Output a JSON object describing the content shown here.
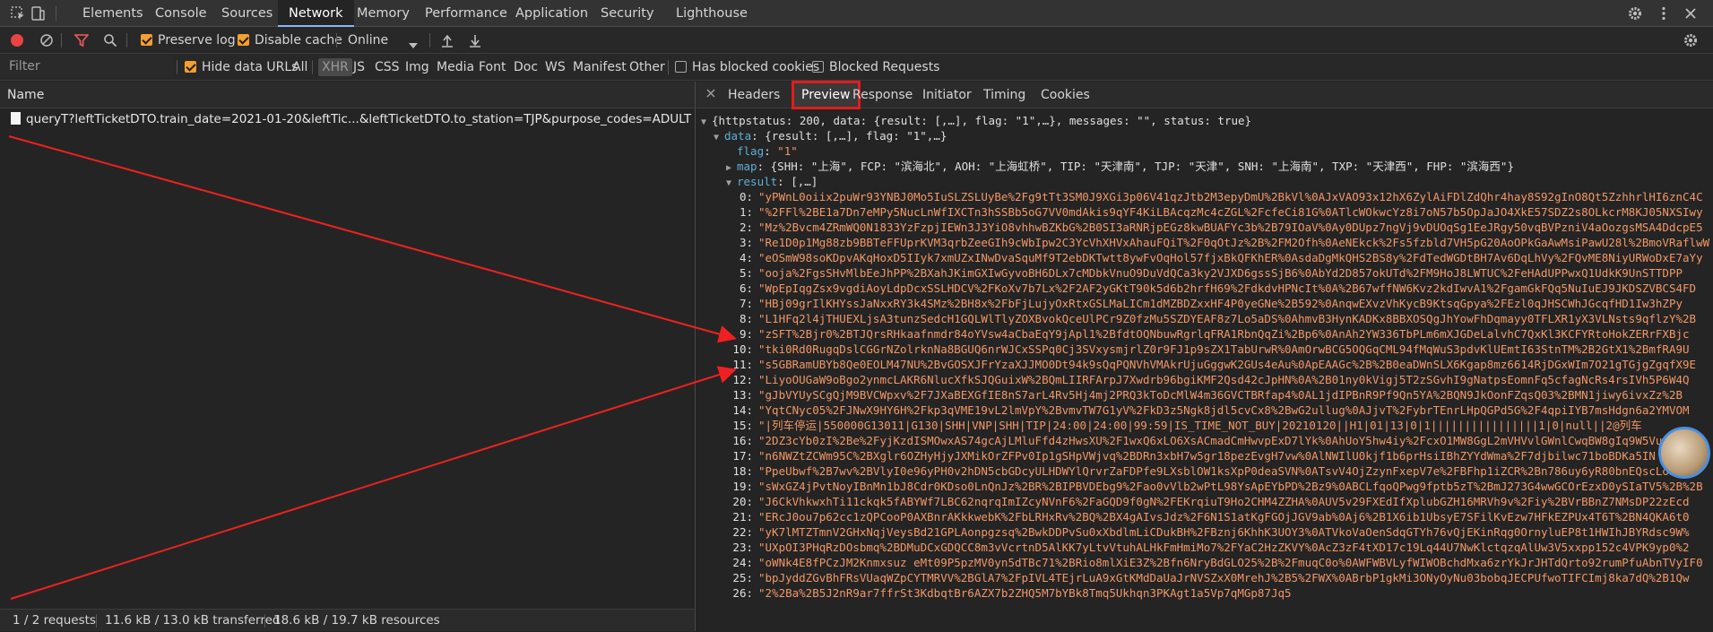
{
  "devtools": {
    "panel_tabs": [
      "Elements",
      "Console",
      "Sources",
      "Network",
      "Memory",
      "Performance",
      "Application",
      "Security",
      "Lighthouse"
    ],
    "active_panel": "Network",
    "icons": {
      "inspect": "cursor-select-icon",
      "device": "device-toolbar-icon",
      "settings": "gear-icon",
      "more": "kebab-menu-icon",
      "close": "close-icon"
    }
  },
  "toolbar": {
    "preserve_log": "Preserve log",
    "disable_cache": "Disable cache",
    "throttle": "Online"
  },
  "filter_bar": {
    "placeholder": "Filter",
    "hide_data_urls": "Hide data URLs",
    "types": [
      "All",
      "XHR",
      "JS",
      "CSS",
      "Img",
      "Media",
      "Font",
      "Doc",
      "WS",
      "Manifest",
      "Other"
    ],
    "active_type": "XHR",
    "has_blocked_cookies": "Has blocked cookies",
    "blocked_requests": "Blocked Requests"
  },
  "request_list": {
    "header": "Name",
    "rows": [
      "queryT?leftTicketDTO.train_date=2021-01-20&leftTic...&leftTicketDTO.to_station=TJP&purpose_codes=ADULT"
    ]
  },
  "status_bar": {
    "requests": "1 / 2 requests",
    "transferred": "11.6 kB / 13.0 kB transferred",
    "resources": "18.6 kB / 19.7 kB resources"
  },
  "detail_tabs": [
    "Headers",
    "Preview",
    "Response",
    "Initiator",
    "Timing",
    "Cookies"
  ],
  "active_detail_tab": "Preview",
  "preview": {
    "root": "{httpstatus: 200, data: {result: [,…], flag: \"1\",…}, messages: \"\", status: true}",
    "data_summary": "{result: [,…], flag: \"1\",…}",
    "flag_value": "\"1\"",
    "map_summary": "{SHH: \"上海\", FCP: \"滨海北\", AOH: \"上海虹桥\", TIP: \"天津南\", TJP: \"天津\", SNH: \"上海南\", TXP: \"天津西\", FHP: \"滨海西\"}",
    "result_summary": "[,…]",
    "results": [
      "\"yPWnL0oiix2puWr93YNBJ0Mo5IuSLZSLUyBe%2Fg9tTt3SM0J9XGi3p06V41qzJtb2M3epyDmU%2BkVl%0AJxVAO93x12hX6ZylAiFDlZdQhr4hay8S92gInO8Qt5ZzhhrlHI6znC4C",
      "\"%2FFl%2BE1a7Dn7eMPy5NucLnWfIXCTn3hSSBb5oG7VV0mdAkis9qYF4KiLBAcqzMc4cZGL%2FcfeCi81G%0ATlcWOkwcYz8i7oN57b5OpJaJO4XkE57SDZ2s8OLkcrM8KJ05NXSIwy",
      "\"Mz%2Bvcm4ZRmWQ0N1833YzFzpjIEWn3J3YiO8vhhwBZKbG%2B0SI3aRNRjpEGz8kwBUAFYc3b%2B79IOaV%0Ay0DUpz7ngVj9vDUOqSg1EeJRgy50vqBVPzniV4aOozgsMSA4DdcpE5",
      "\"Re1D0p1Mg88zb9BBTeFFUprKVM3qrbZeeGIh9cWbIpw2C3YcVhXHVxAhauFQiT%2F0qOtJz%2B%2FM2Ofh%0AeNEkck%2Fs5fzbld7VH5pG20AoOPkGaAwMsiPawU28l%2BmoVRaflwW",
      "\"eOSmW98soKDpvAKqHoxD5IIyk7xmUZxINwDvaSquMf9T2ebDKTwtt8ywFvOqHol57fjxBkQFKhER%0AsdaDgMkQHS2BS8y%2FdTedWGDtBH7Av6DqLhVy%2FQvME8NiyURWoDxE7aYy",
      "\"ooja%2FgsSHvMlbEeJhPP%2BXahJKimGXIwGyvoBH6DLx7cMDbkVnuO9DuVdQCa3ky2VJXD6gssSjB6%0AbYd2D857okUTd%2FM9HoJ8LWTUC%2FeHAdUPPwxQ1UdkK9UnSTTDPP",
      "\"WpEpIqgZsx9vgdiAoyLdpDcxSSLHDCV%2FKoXv7b7Lx%2F2AF2yGKtT90k5d6b2hrfH69%2FdkdvHPNcIt%0A%2B67wffNW6Kvz2kdIwvA1%2FgamGkFQq5NuIuEJ9JKDSZVBCS4FD",
      "\"HBj09grIlKHYssJaNxxRY3k4SMz%2BH8x%2FbFjLujyOxRtxGSLMaLICm1dMZBDZxxHF4P0yeGNe%2B592%0AnqwEXvzVhKycB9KtsqGpya%2FEzl0qJHSCWhJGcqfHD1Iw3hZPy",
      "\"L1HFq2l4jTHUEXLjsA3tunzSedcH1GQLWlTlyZOXBvokQceUlPCr9Z0fzMu5SZDYEAF8z7Lo5aDS%0AhmvB3HynKADKx8BBXOSQgJhYowFhDqmayy0TFLXR1yX3VLNsts9qflzY%2B",
      "\"zSFT%2Bjr0%2BTJQrsRHkaafnmdr84oYVsw4aCbaEqY9jApl1%2BfdtOQNbuwRgrlqFRA1RbnQqZi%2Bp6%0AnAh2YW336TbPLm6mXJGDeLalvhC7QxKl3KCFYRtoHokZERrFXBjc",
      "\"tki0Rd0RugqDslCGGrNZolrknNa8BGUQ6nrWJCxSSPq0Cj3SVxysmjrlZ0r9FJ1p9sZX1TabUrwR%0AmOrwBCG5OQGqCML94fMqWuS3pdvKlUEmtI63StnTM%2B2GtX1%2BmfRA9U",
      "\"s5GBRamUBYb8Qe0EOLM47NU%2BvGOSXJFrYzaXJJMO0Dt94k9sQqPQNVhVMAkrUjuGggwK2GUs4eAu%0ApEAAGc%2B%2B0eaDWnSLX6Kgap8mz6614RjDGxWIm7O21gTGjgZgqfX9E",
      "\"LiyoOUGaW9oBgo2ynmcLAKR6NlucXfkSJQGuixW%2BQmLIIRFArpJ7Xwdrb96bgiKMF2Qsd42cJpHN%0A%2B01ny0kVigj5T2zSGvhI9gNatpsEomnFq5cfagNcRs4rsIVh5P6W4Q",
      "\"gJbVYUySCgQjM9BVCWpxv%2F7JXaBEXGfIE8nS7arL4Rv5Hj4mj2PRQ3kToDcMlW4m36GVCTBRfap4%0AL1jdIPBnR9Pf9Qn5YA%2BQN9JkOonFZqsQ03%2BMN1jiwy6ivxZz%2B",
      "\"YqtCNyc05%2FJNwX9HY6H%2Fkp3qVME19vL2lmVpY%2BvmvTW7G1yV%2FkD3z5Ngk8jdl5cvCx8%2BwG2ullug%0AJjvT%2FybrTEnrLHpQGPd5G%2F4qpiIYB7msHdgn6a2YMVOM",
      "\"|列车停运|550000G13011|G130|SHH|VNP|SHH|TIP|24:00|24:00|99:59|IS_TIME_NOT_BUY|20210120||H1|01|13|0|1||||||||||||||||1|0|null||2@列车",
      "\"2DZ3cYb0zI%2Be%2FyjKzdISMOwxAS74gcAjLMluFfd4zHwsXU%2F1wxQ6xLO6XsACmadCmHwvpExD7lYk%0AhUoY5hw4iy%2FcxO1MW8GgL2mVHVvlGWnlCwqBW8gIq9W5VuS",
      "\"n6NWZtZCWm95C%2BXglr6OZHyHjyJXMikOrZFPv0Ip1gSHpVWjvq%2BDRn3xbH7w5gr18pezEvgH7vw%0AlNWIlU0kjf1b6prHsiIBhZYYdWma%2F7djbilwc71boBDKa5IN",
      "\"PpeUbwf%2B7wv%2BVlyI0e96yPH0v2hDN5cbGDcyULHDWYlQrvrZaFDPfe9LXsblOW1ksXpP0deaSVN%0ATsvV4OjZzynFxepV7e%2FBFhp1iZCR%2Bn786uy6yR80bnEQscLonS",
      "\"sWxGZ4jPvtNoyIBnMn1bJ8Cdr0KDso0LnQnJz%2BR%2BIPBVDEbg9%2Fao0vVlb2wPtL98YsApEYbPD%2Bz9%0ABCLfqoQPwg9fptb5zT%2BmJ273G4wwGCOrEzxD0ySIaTV5%2B%2B",
      "\"J6CkVhkwxhTi11ckqk5fABYWf7LBC62nqrqImIZcyNVnF6%2FaGQD9f0gN%2FEKrqiuT9Ho2CHM4ZZHA%0AUV5v29FXEdIfXplubGZH16MRVh9v%2Fiy%2BVrBBnZ7NMsDP22zEcd",
      "\"ERcJ0ou7p62cc1zQPCooP0AXBnrAKkkwebK%2FbLRHxRv%2BQ%2BX4gAIvsJdz%2F6N1S1atKgFGOjJGV9ab%0Aj6%2B1X6ib1UbsyE7SFilKvEzw7HFkEZPUx4T6T%2BN4QKA6t0",
      "\"yK7lMTZTmnV2GHxNqjVeysBd21GPLAonpgzsq%2BwkDDPvSu0xXbdlmLiCDukBH%2FBznj6KhhK3UOY3%0ATVkoVaOenSdqGTYh76vQjEKinRqg0OrnyluEP8t1HWIhJBYRdsc9W%",
      "\"UXpOI3PHqRzDOsbmq%2BDMuDCxGDQCC8m3vVcrtnD5AlKK7yLtvVtuhALHkFmHmiMo7%2FYaC2HzZKVY%0AcZ3zF4tXD17c19Lq44U7NwKlctqzqAlUw3V5xxpp152c4VPK9yp0%2",
      "\"oWNk4E8fPCzJM2Knmxsuz eMt09P5pzMV0yn5dTBc71%2BRio8mlXiE3Z%2Bfn6NryBdGLO25%2B%2FmuqC0o%0AWFWBVLyfWIWOBchdMxa6zrYkJrJHTdQrto92rumPfuAbnTVyIF0",
      "\"bpJyddZGvBhFRsVUaqWZpCYTMRVV%2BGlA7%2FpIVL4TEjrLuA9xGtKMdDaUaJrNVSZxX0MrehJ%2B5%2FWX%0ABrbP1gkMi3ONyOyNu03bobqJECPUfwoTIFCImj8ka7dQ%2B1Qw",
      "\"2%2Ba%2B5J2nR9ar7ffrSt3KdbqtBr6AZX7b2ZHQ5M7bYBk8Tmq5Ukhqn3PKAgt1a5Vp7qMGp87Jq5"
    ]
  }
}
